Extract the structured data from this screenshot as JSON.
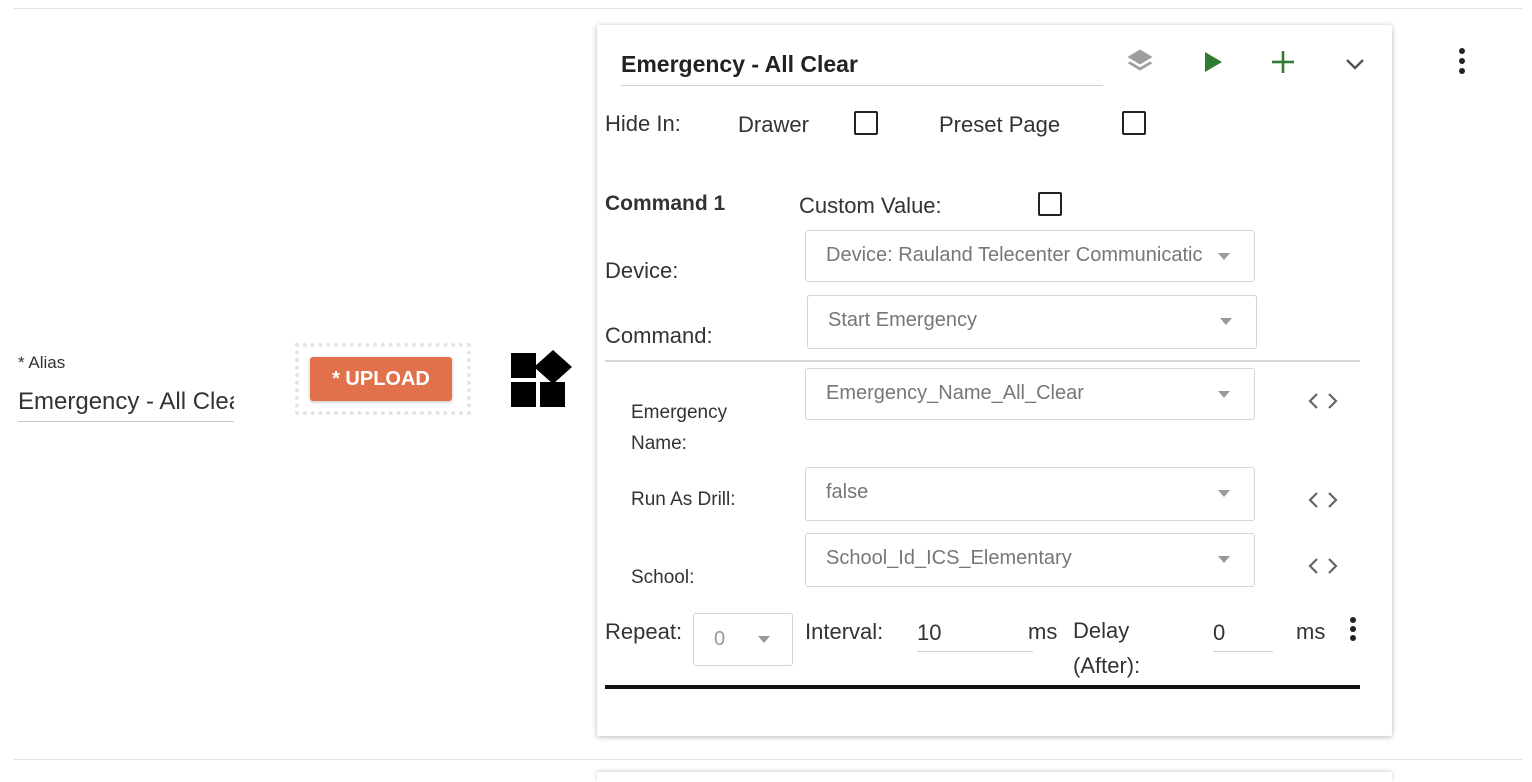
{
  "alias": {
    "label": "* Alias",
    "value": "Emergency - All Clea"
  },
  "upload": {
    "label": "* UPLOAD"
  },
  "card": {
    "title": "Emergency - All Clear",
    "toolbar": {
      "layers_icon": "layers-icon",
      "play_icon": "play-icon",
      "add_icon": "plus-icon",
      "expand_icon": "chevron-down-icon",
      "more_icon": "more-vert-icon"
    },
    "hide_in": {
      "label": "Hide In:",
      "drawer_label": "Drawer",
      "preset_page_label": "Preset Page"
    },
    "command": {
      "heading": "Command 1",
      "custom_value_label": "Custom Value:",
      "device_label": "Device:",
      "device_value": "Device: Rauland Telecenter Communicatic",
      "command_label": "Command:",
      "command_value": "Start Emergency",
      "params": [
        {
          "label": "Emergency Name:",
          "value": "Emergency_Name_All_Clear"
        },
        {
          "label": "Run As Drill:",
          "value": "false"
        },
        {
          "label": "School:",
          "value": "School_Id_ICS_Elementary"
        }
      ],
      "repeat_label": "Repeat:",
      "repeat_value": "0",
      "interval_label": "Interval:",
      "interval_value": "10",
      "interval_unit": "ms",
      "delay_label": "Delay (After):",
      "delay_value": "0",
      "delay_unit": "ms"
    }
  },
  "colors": {
    "upload_bg": "#e0714a",
    "play_green": "#2e7d32",
    "plus_green": "#2e7d32",
    "icon_gray": "#9e9e9e"
  }
}
